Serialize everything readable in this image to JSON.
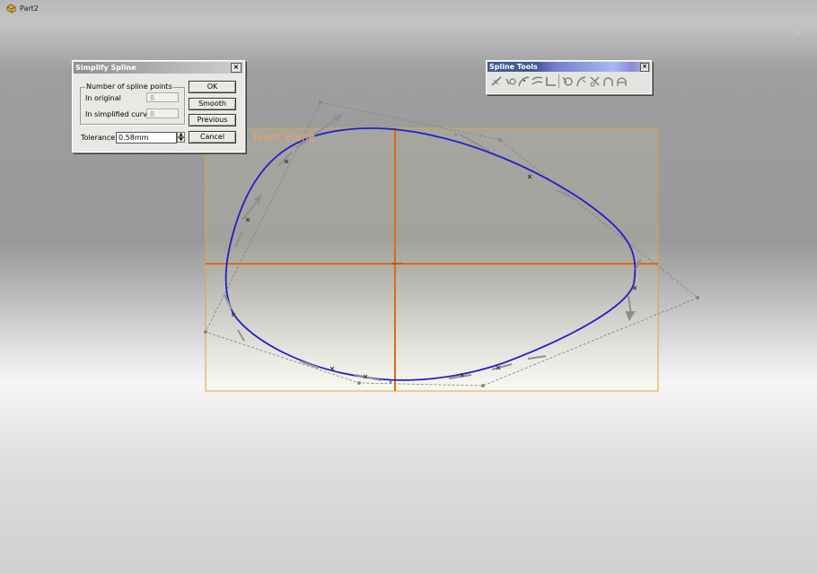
{
  "document": {
    "title": "Part2",
    "icon": "part-icon"
  },
  "plane_label": "Front Plane",
  "dialog": {
    "title": "Simplify Spline",
    "group_title": "Number of spline points",
    "in_original_label": "In original",
    "in_original_value": "8",
    "in_simplified_label": "In simplified curve:",
    "in_simplified_value": "8",
    "tolerance_label": "Tolerance",
    "tolerance_value": "0.58mm",
    "buttons": {
      "ok": "OK",
      "smooth": "Smooth",
      "previous": "Previous",
      "cancel": "Cancel"
    }
  },
  "toolbar": {
    "title": "Spline Tools",
    "tools": [
      "add-tangency-control-icon",
      "add-curvature-control-icon",
      "insert-spline-point-icon",
      "simplify-spline-icon",
      "show-inflection-points-icon",
      "show-minimum-radius-icon",
      "show-curvature-combs-icon",
      "fit-spline-icon",
      "convert-entities-icon",
      "intersection-curve-icon",
      "face-curves-icon"
    ]
  },
  "colors": {
    "spline": "#2020c8",
    "plane_box": "#e8a040",
    "axes": "#e06a10",
    "control_polygon": "#777777",
    "background_top": "#9e9e9e",
    "background_bottom": "#f4f4f4"
  }
}
